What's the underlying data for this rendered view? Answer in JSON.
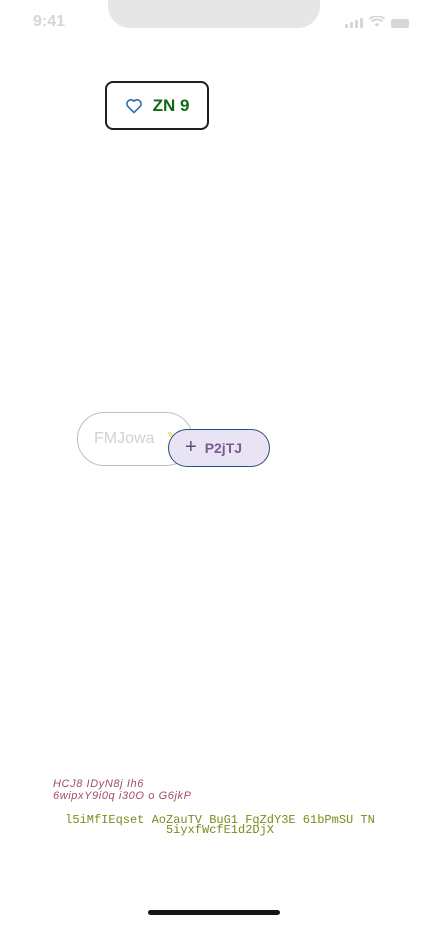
{
  "status_bar": {
    "time": "9:41"
  },
  "chip_zn": {
    "label": "ZN 9",
    "icon": "heart-icon",
    "accent": "#0d6a10"
  },
  "ghost_pill": {
    "label": "FMJowa",
    "icon": "chevron-right-icon"
  },
  "add_pill": {
    "label": "P2jTJ",
    "icon": "plus-icon"
  },
  "text_block_1": {
    "line1": "HCJ8 IDyN8j Ih6",
    "line2": "6wipxY9i0q  i30O o G6jkP"
  },
  "text_block_2": {
    "line1": "l5iMfIEqset AoZauTV BuG1 FqZdY3E 61bPmSU TN",
    "line2": "5iyxfWcfE1d2DjX"
  }
}
